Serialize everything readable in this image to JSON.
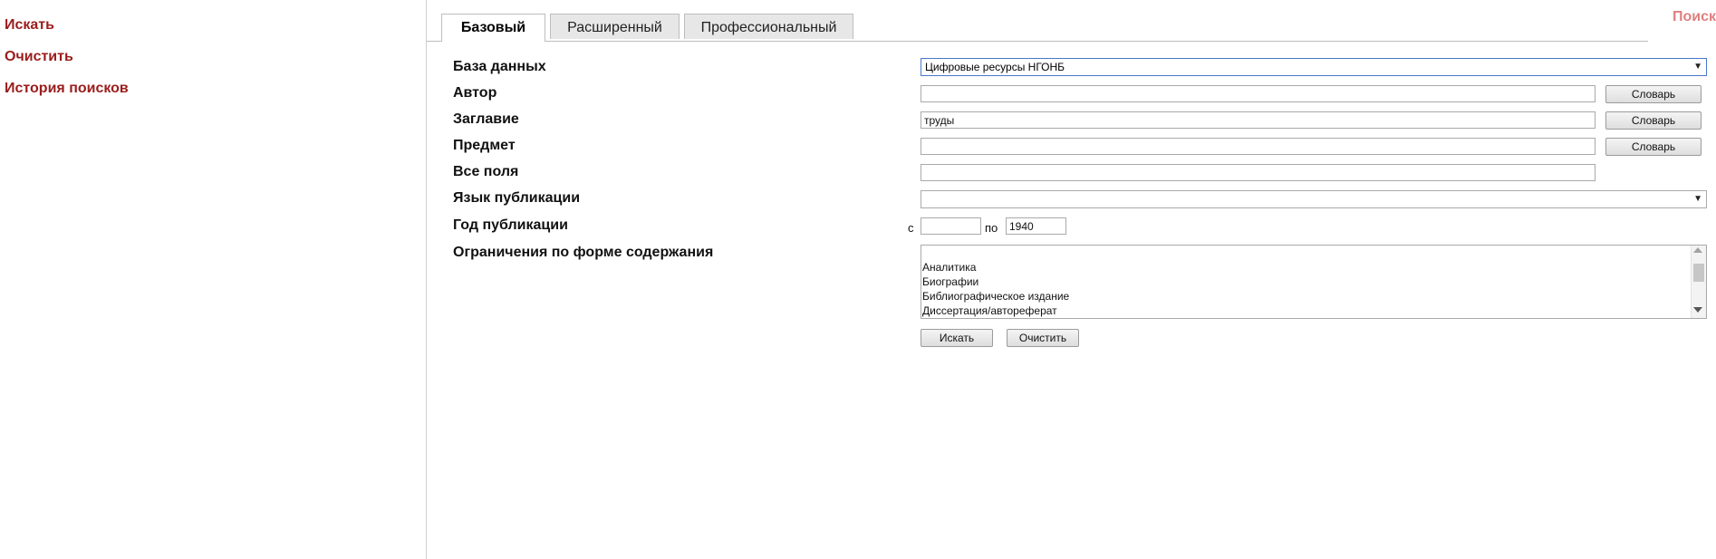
{
  "sidebar": {
    "links": [
      "Искать",
      "Очистить",
      "История поисков"
    ]
  },
  "header": {
    "top_right_text": "Поиск"
  },
  "tabs": [
    {
      "label": "Базовый",
      "active": true
    },
    {
      "label": "Расширенный",
      "active": false
    },
    {
      "label": "Профессиональный",
      "active": false
    }
  ],
  "form": {
    "labels": {
      "database": "База данных",
      "author": "Автор",
      "title": "Заглавие",
      "subject": "Предмет",
      "all_fields": "Все поля",
      "language": "Язык публикации",
      "year": "Год публикации",
      "content_limits": "Ограничения по форме содержания"
    },
    "database_value": "Цифровые ресурсы НГОНБ",
    "author_value": "",
    "title_value": "труды",
    "subject_value": "",
    "all_fields_value": "",
    "language_value": "",
    "year_from_label": "с",
    "year_to_label": "по",
    "year_from_value": "",
    "year_to_value": "1940",
    "dictionary_label": "Словарь",
    "content_options": [
      "Аналитика",
      "Биографии",
      "Библиографическое издание",
      "Диссертация/автореферат"
    ],
    "search_button": "Искать",
    "clear_button": "Очистить"
  },
  "icons": [
    "dropdown-arrow-icon",
    "scroll-up-icon",
    "scroll-down-icon"
  ]
}
